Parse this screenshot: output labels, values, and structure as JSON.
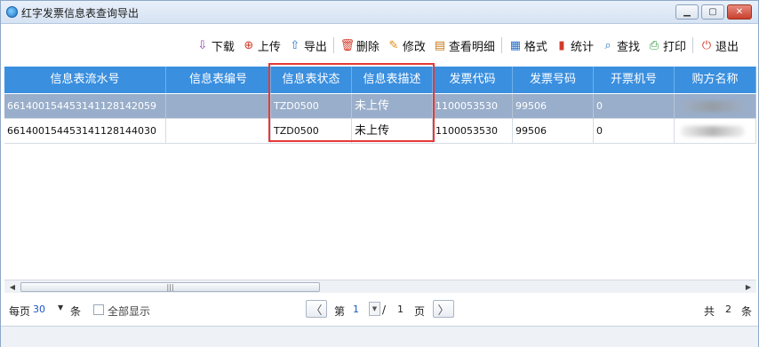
{
  "window": {
    "title": "红字发票信息表查询导出",
    "min_label": "▁",
    "max_label": "▢",
    "close_label": "✕"
  },
  "toolbar": [
    {
      "name": "download",
      "label": "下载",
      "icon": "download-icon",
      "glyph": "⇩",
      "color": "#8e3fb8"
    },
    {
      "name": "upload",
      "label": "上传",
      "icon": "upload-icon",
      "glyph": "⊕",
      "color": "#d23a2a"
    },
    {
      "name": "export",
      "label": "导出",
      "icon": "export-icon",
      "glyph": "⇧",
      "color": "#2d72c8"
    },
    {
      "name": "delete",
      "label": "删除",
      "icon": "trash-icon",
      "glyph": "🗑",
      "color": "#d23a2a"
    },
    {
      "name": "edit",
      "label": "修改",
      "icon": "edit-icon",
      "glyph": "✎",
      "color": "#e08a14"
    },
    {
      "name": "view-detail",
      "label": "查看明细",
      "icon": "detail-icon",
      "glyph": "▤",
      "color": "#c87b1e"
    },
    {
      "name": "format",
      "label": "格式",
      "icon": "format-icon",
      "glyph": "▦",
      "color": "#2d72c8"
    },
    {
      "name": "stats",
      "label": "统计",
      "icon": "bar-chart-icon",
      "glyph": "▮",
      "color": "#d23a2a"
    },
    {
      "name": "search",
      "label": "查找",
      "icon": "search-icon",
      "glyph": "⌕",
      "color": "#2d72c8"
    },
    {
      "name": "print",
      "label": "打印",
      "icon": "printer-icon",
      "glyph": "⎙",
      "color": "#2e9a3a"
    },
    {
      "name": "exit",
      "label": "退出",
      "icon": "power-icon",
      "glyph": "⏻",
      "color": "#d23a2a"
    }
  ],
  "table": {
    "columns": [
      "信息表流水号",
      "信息表编号",
      "信息表状态",
      "信息表描述",
      "发票代码",
      "发票号码",
      "开票机号",
      "购方名称"
    ],
    "rows": [
      [
        "661400154453141128142059",
        "",
        "TZD0500",
        "未上传",
        "1100053530",
        "99506",
        "0",
        ""
      ],
      [
        "661400154453141128144030",
        "",
        "TZD0500",
        "未上传",
        "1100053530",
        "99506",
        "0",
        ""
      ]
    ]
  },
  "scrollbar": {
    "thumb_grip": "|||"
  },
  "pager": {
    "per_page_label": "每页",
    "per_page_value": "30",
    "per_page_unit": "条",
    "show_all_label": "全部显示",
    "page_prefix": "第",
    "current_page": "1",
    "slash": "/",
    "total_pages": "1",
    "page_suffix": "页",
    "prev_label": "〈",
    "next_label": "〉",
    "total_prefix": "共",
    "total_count": "2",
    "total_suffix": "条"
  },
  "colors": {
    "header_bg": "#3a8fdf",
    "selected_row_bg": "#99aeca",
    "highlight_border": "#e53935"
  }
}
